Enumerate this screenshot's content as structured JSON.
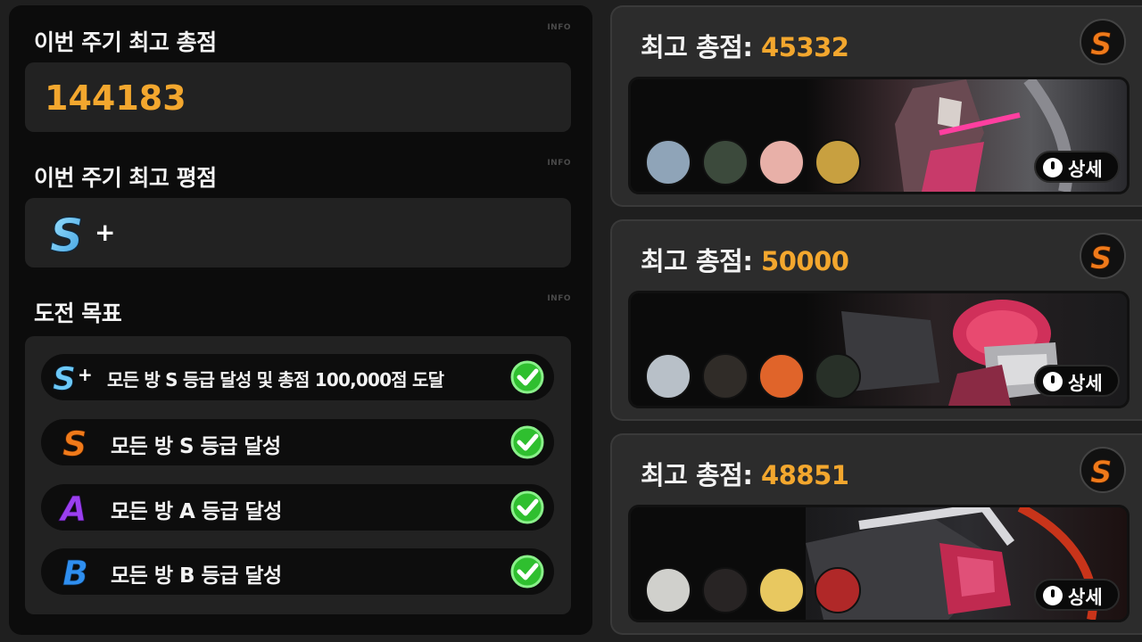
{
  "left": {
    "total": {
      "title": "이번 주기 최고 총점",
      "info": "INFO",
      "value": "144183"
    },
    "rating": {
      "title": "이번 주기 최고 평점",
      "info": "INFO",
      "grade": "S+"
    },
    "goals": {
      "title": "도전 목표",
      "info": "INFO",
      "items": [
        {
          "grade": "S+",
          "text": "모든 방 S 등급 달성 및 총점 100,000점 도달",
          "done": true
        },
        {
          "grade": "S",
          "text": "모든 방 S 등급 달성",
          "done": true
        },
        {
          "grade": "A",
          "text": "모든 방 A 등급 달성",
          "done": true
        },
        {
          "grade": "B",
          "text": "모든 방 B 등급 달성",
          "done": true
        }
      ]
    }
  },
  "cards": [
    {
      "label": "최고 총점:",
      "score": "45332",
      "grade": "S",
      "detail": "상세"
    },
    {
      "label": "최고 총점:",
      "score": "50000",
      "grade": "S",
      "detail": "상세"
    },
    {
      "label": "최고 총점:",
      "score": "48851",
      "grade": "S",
      "detail": "상세"
    }
  ],
  "colors": {
    "score_accent": "#f3a72e",
    "grade_s": "#f07a1a",
    "grade_a": "#9b3ff0",
    "grade_b": "#2f8ff0",
    "grade_splus": "#5cc3f5",
    "check_green": "#3bcf3b"
  }
}
